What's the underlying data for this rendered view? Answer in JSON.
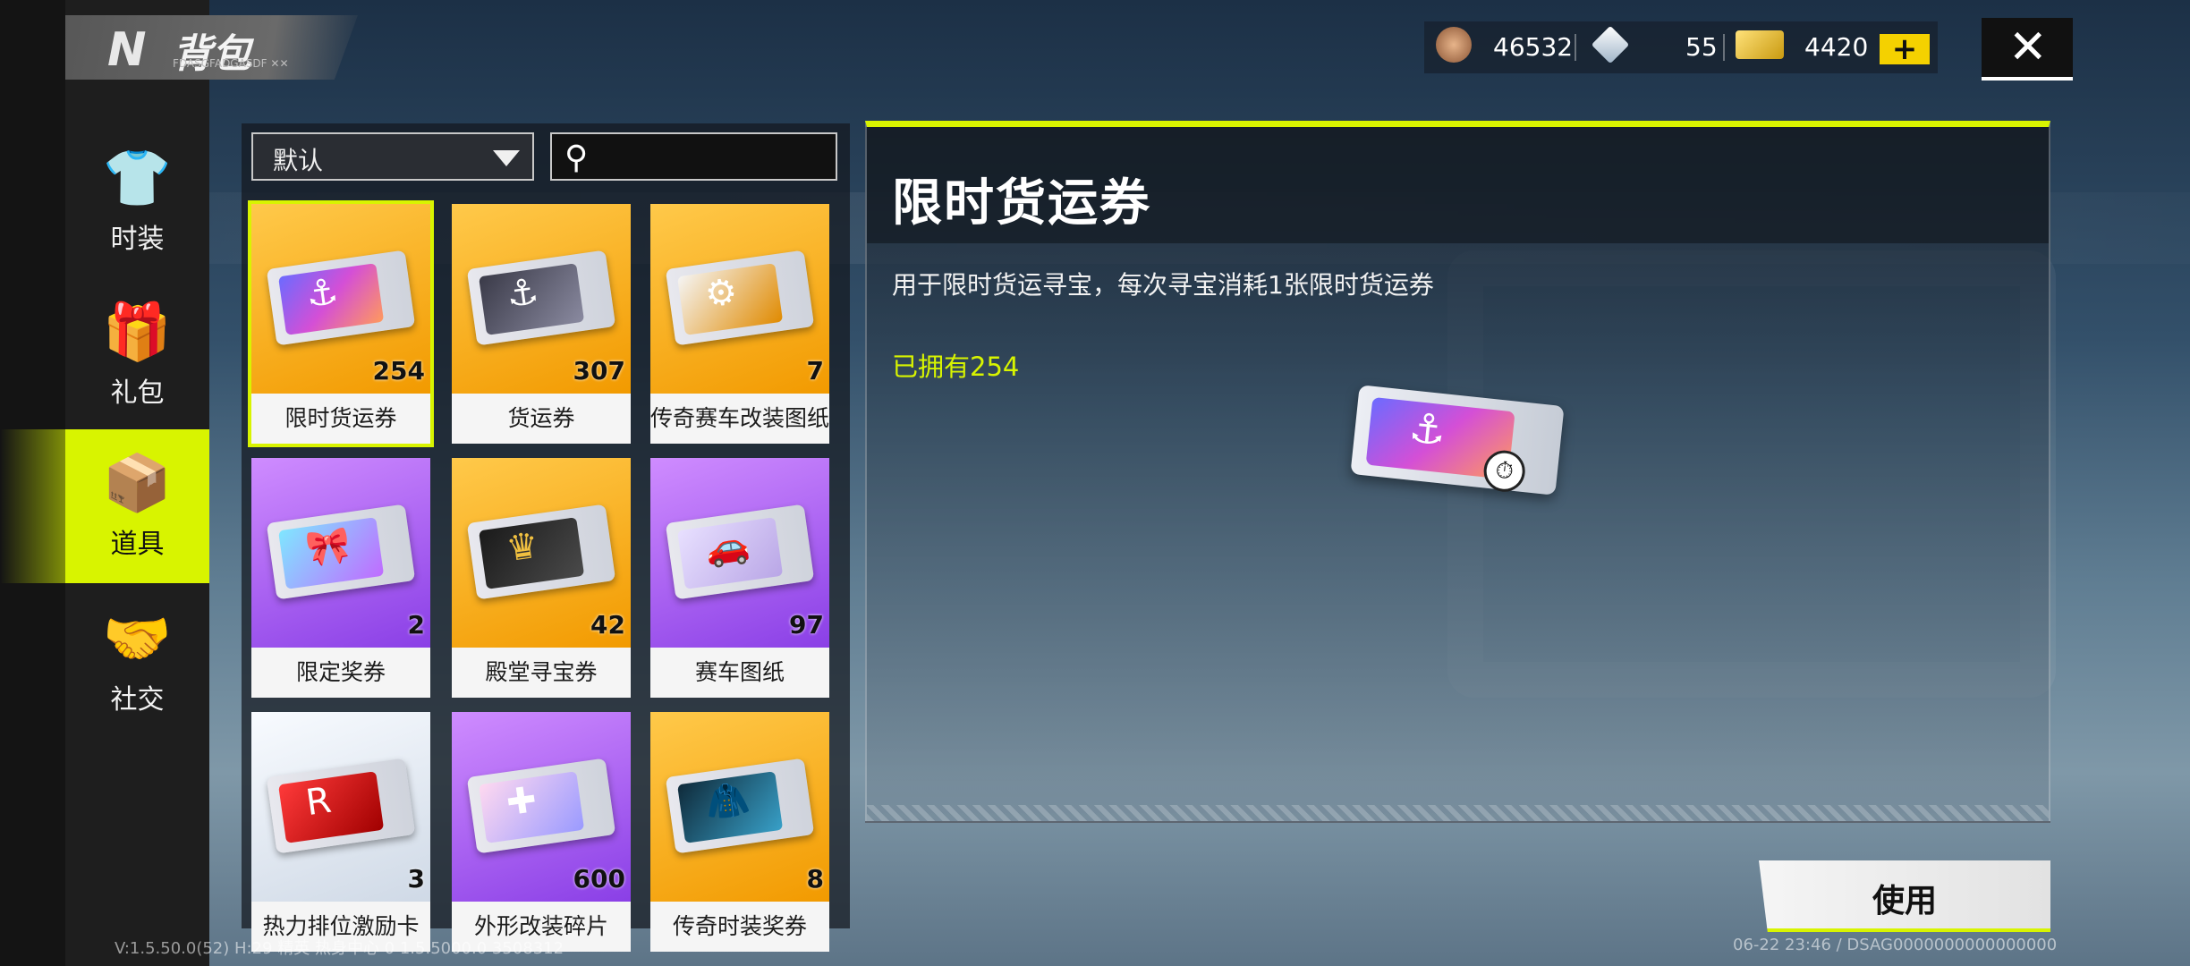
{
  "header": {
    "logo": "N",
    "title": "背包",
    "subtitle": "FDASGFADGASDF ✕✕"
  },
  "currencies": {
    "coins": "46532",
    "diamonds": "55",
    "tickets": "4420",
    "plus": "+"
  },
  "close": "✕",
  "sidebar": {
    "items": [
      {
        "label": "时装",
        "icon": "shirt-icon",
        "glyph": "👕"
      },
      {
        "label": "礼包",
        "icon": "gift-icon",
        "glyph": "🎁"
      },
      {
        "label": "道具",
        "icon": "box-icon",
        "glyph": "📦"
      },
      {
        "label": "社交",
        "icon": "handshake-icon",
        "glyph": "🤝"
      }
    ],
    "active": "道具"
  },
  "filter": {
    "selected": "默认"
  },
  "items": [
    {
      "name": "限时货运券",
      "count": "254",
      "bg": "orange",
      "selected": true
    },
    {
      "name": "货运券",
      "count": "307",
      "bg": "orange"
    },
    {
      "name": "传奇赛车改装图纸",
      "count": "7",
      "bg": "orange"
    },
    {
      "name": "限定奖券",
      "count": "2",
      "bg": "purple"
    },
    {
      "name": "殿堂寻宝券",
      "count": "42",
      "bg": "orange"
    },
    {
      "name": "赛车图纸",
      "count": "97",
      "bg": "purple"
    },
    {
      "name": "热力排位激励卡",
      "count": "3",
      "bg": "white"
    },
    {
      "name": "外形改装碎片",
      "count": "600",
      "bg": "purple"
    },
    {
      "name": "传奇时装奖券",
      "count": "8",
      "bg": "orange"
    }
  ],
  "detail": {
    "title": "限时货运券",
    "description": "用于限时货运寻宝，每次寻宝消耗1张限时货运券",
    "owned": "已拥有254"
  },
  "use_button": "使用",
  "footer": {
    "version": "V:1.5.50.0(52) H:29 精英 热身中心 0 1.5.5000.0 3508312",
    "timestamp": "06-22 23:46 / DSAG0000000000000000"
  }
}
